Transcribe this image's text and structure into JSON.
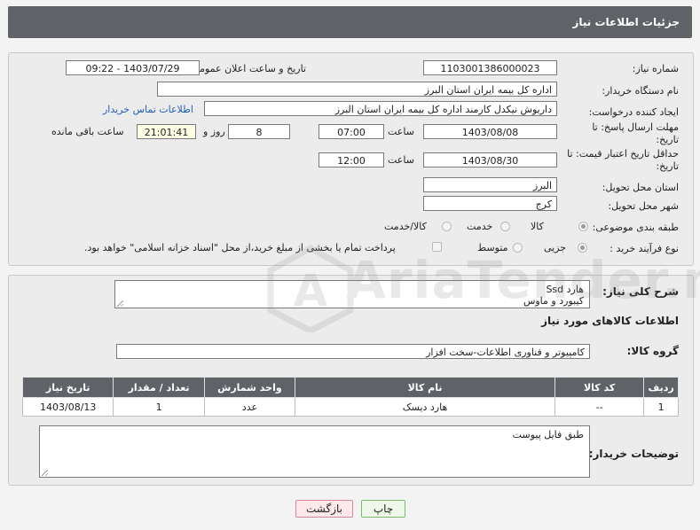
{
  "header": {
    "title": "جزئیات اطلاعات نیاز"
  },
  "form": {
    "need_number_label": "شماره نیاز:",
    "need_number": "1103001386000023",
    "announce_label": "تاریخ و ساعت اعلان عمومی:",
    "announce_value": "1403/07/29 - 09:22",
    "buyer_org_label": "نام دستگاه خریدار:",
    "buyer_org": "اداره کل بیمه ایران استان البرز",
    "creator_label": "ایجاد کننده درخواست:",
    "creator": "داریوش  نیکدل کارمند  اداره کل بیمه ایران استان البرز",
    "contact_link": "اطلاعات تماس خریدار",
    "deadline_label_1": "مهلت ارسال پاسخ: تا",
    "deadline_label_2": "تاریخ:",
    "deadline_date": "1403/08/08",
    "time_label": "ساعت",
    "deadline_time": "07:00",
    "days_value": "8",
    "days_label": "روز و",
    "remaining_time": "21:01:41",
    "remaining_label": "ساعت باقی مانده",
    "validity_label_1": "حداقل تاریخ اعتبار قیمت: تا",
    "validity_label_2": "تاریخ:",
    "validity_date": "1403/08/30",
    "validity_time": "12:00",
    "province_label": "استان محل تحویل:",
    "province": "البرز",
    "city_label": "شهر محل تحویل:",
    "city": "کرج",
    "category_label": "طبقه بندی موضوعی:",
    "category_options": [
      "کالا",
      "خدمت",
      "کالا/خدمت"
    ],
    "process_label": "نوع فرآیند خرید :",
    "process_options": [
      "جزیی",
      "متوسط"
    ],
    "payment_note": "پرداخت تمام یا بخشی از مبلغ خرید،از محل \"اسناد خزانه اسلامی\" خواهد بود."
  },
  "summary": {
    "label": "شرح کلی نیاز:",
    "text": "هارد Ssd\nکیبورد و ماوس"
  },
  "goods": {
    "section_title": "اطلاعات کالاهای مورد نیاز",
    "group_label": "گروه کالا:",
    "group_value": "کامپیوتر و فناوری اطلاعات-سخت افزار",
    "columns": [
      "ردیف",
      "کد کالا",
      "نام کالا",
      "واحد شمارش",
      "تعداد / مقدار",
      "تاریخ نیاز"
    ],
    "rows": [
      [
        "1",
        "--",
        "هارد دیسک",
        "عدد",
        "1",
        "1403/08/13"
      ]
    ]
  },
  "buyer_notes": {
    "label": "توضیحات خریدار:",
    "text": "طبق فایل پیوست"
  },
  "buttons": {
    "print": "چاپ",
    "back": "بازگشت"
  },
  "watermark": {
    "text": "AriaTender.net"
  },
  "colors": {
    "header_bg": "#5f6368",
    "link": "#1f5fbf",
    "panel_bg": "#ececec"
  }
}
